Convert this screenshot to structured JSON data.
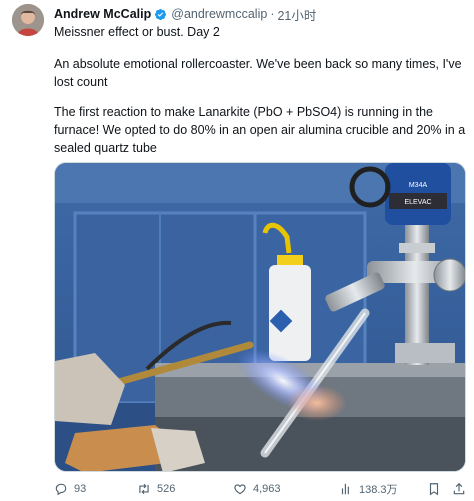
{
  "tweet": {
    "display_name": "Andrew McCalip",
    "handle": "@andrewmccalip",
    "separator": "·",
    "timestamp": "21小时",
    "line1": "Meissner effect or bust. Day 2",
    "para2": "An absolute emotional rollercoaster. We've been back so many times, I've lost count",
    "para3": "The first reaction to make Lanarkite (PbO + PbSO4) is running in the furnace! We opted to do 80% in an open air alumina crucible and 20% in a sealed quartz tube",
    "image_text": {
      "gauge_model": "M34A",
      "gauge_brand": "ELEVAC"
    }
  },
  "actions": {
    "reply_count": "93",
    "retweet_count": "526",
    "like_count": "4,963",
    "views_count": "138.3万"
  },
  "colors": {
    "text_primary": "#0f1419",
    "text_secondary": "#536471",
    "verified_badge": "#1d9bf0",
    "flame_blue": "#6f8cff"
  },
  "icons": {
    "verified": "verified-badge-icon",
    "reply": "reply-icon",
    "retweet": "retweet-icon",
    "like": "heart-icon",
    "views": "views-bar-chart-icon",
    "bookmark": "bookmark-icon",
    "share": "share-icon"
  }
}
